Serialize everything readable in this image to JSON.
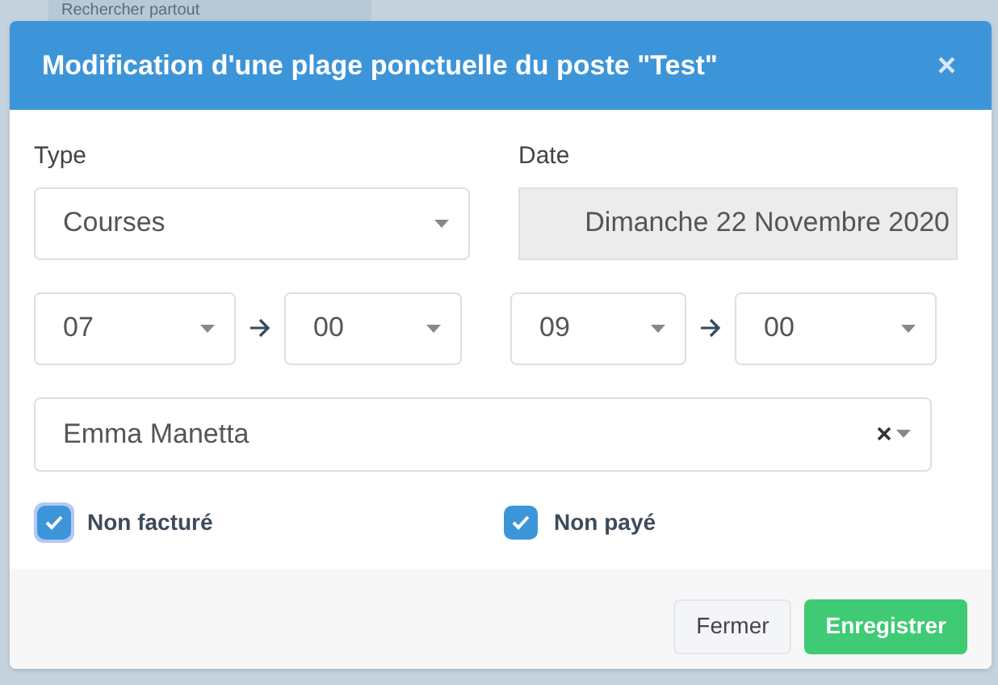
{
  "background": {
    "search_placeholder": "Rechercher partout"
  },
  "dialog": {
    "title": "Modification d'une plage ponctuelle du poste \"Test\"",
    "close": "×",
    "type_field": {
      "label": "Type",
      "value": "Courses"
    },
    "date_field": {
      "label": "Date",
      "value": "Dimanche 22 Novembre 2020",
      "disabled": true
    },
    "start": {
      "hour": "07",
      "minute": "00"
    },
    "end": {
      "hour": "09",
      "minute": "00"
    },
    "person": {
      "value": "Emma Manetta"
    },
    "checkboxes": [
      {
        "label": "Non facturé",
        "checked": true,
        "focused": true
      },
      {
        "label": "Non payé",
        "checked": true,
        "focused": false
      }
    ],
    "buttons": [
      {
        "label": "Fermer",
        "kind": "secondary"
      },
      {
        "label": "Enregistrer",
        "kind": "primary"
      }
    ]
  }
}
